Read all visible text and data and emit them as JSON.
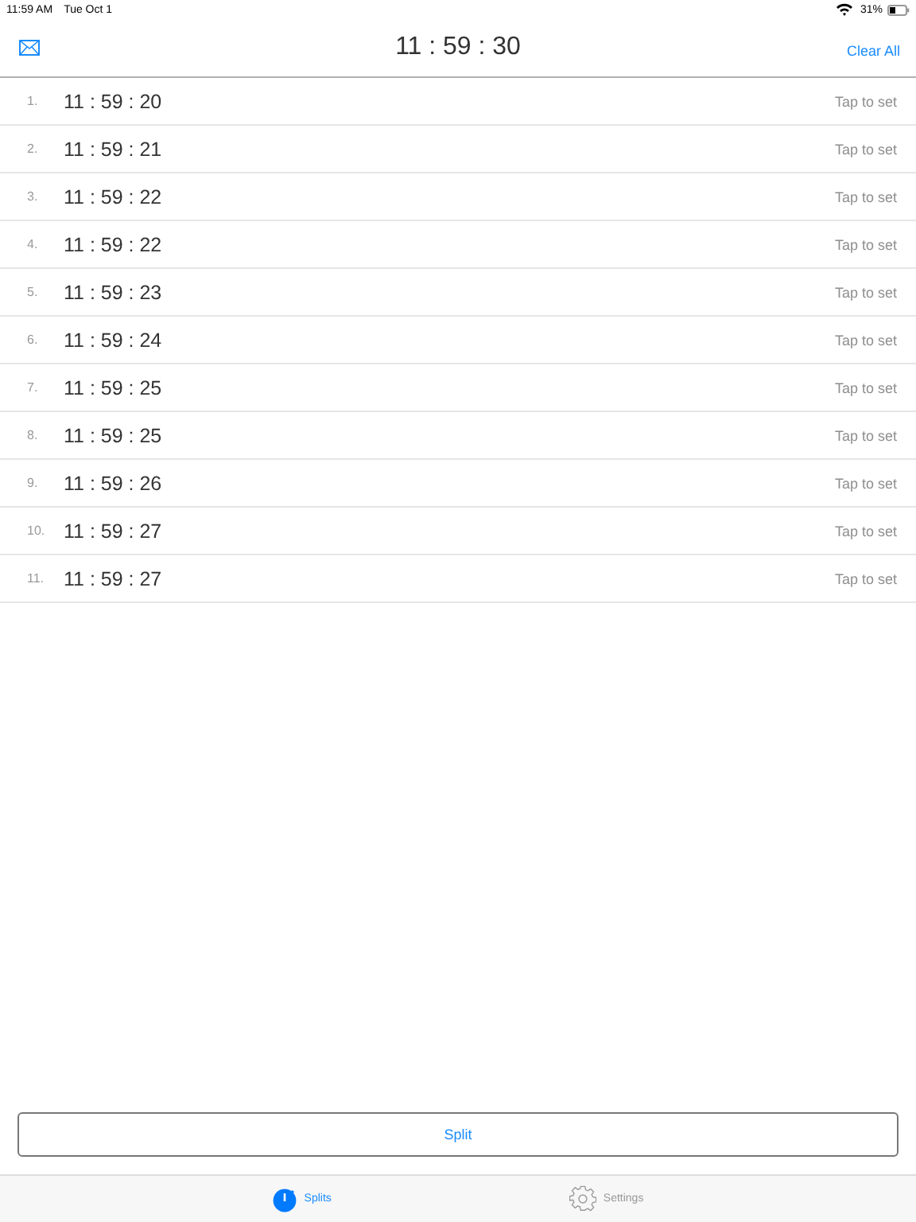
{
  "status_bar": {
    "time": "11:59 AM",
    "date": "Tue Oct 1",
    "battery": "31%"
  },
  "nav": {
    "title": "11 : 59 : 30",
    "action": "Clear All"
  },
  "splits": [
    {
      "index": "1.",
      "time": "11 : 59 : 20",
      "hint": "Tap to set"
    },
    {
      "index": "2.",
      "time": "11 : 59 : 21",
      "hint": "Tap to set"
    },
    {
      "index": "3.",
      "time": "11 : 59 : 22",
      "hint": "Tap to set"
    },
    {
      "index": "4.",
      "time": "11 : 59 : 22",
      "hint": "Tap to set"
    },
    {
      "index": "5.",
      "time": "11 : 59 : 23",
      "hint": "Tap to set"
    },
    {
      "index": "6.",
      "time": "11 : 59 : 24",
      "hint": "Tap to set"
    },
    {
      "index": "7.",
      "time": "11 : 59 : 25",
      "hint": "Tap to set"
    },
    {
      "index": "8.",
      "time": "11 : 59 : 25",
      "hint": "Tap to set"
    },
    {
      "index": "9.",
      "time": "11 : 59 : 26",
      "hint": "Tap to set"
    },
    {
      "index": "10.",
      "time": "11 : 59 : 27",
      "hint": "Tap to set"
    },
    {
      "index": "11.",
      "time": "11 : 59 : 27",
      "hint": "Tap to set"
    }
  ],
  "split_button": "Split",
  "tabs": [
    {
      "label": "Splits",
      "kind": "stopwatch",
      "selected": true
    },
    {
      "label": "Settings",
      "kind": "gear",
      "selected": false
    }
  ]
}
